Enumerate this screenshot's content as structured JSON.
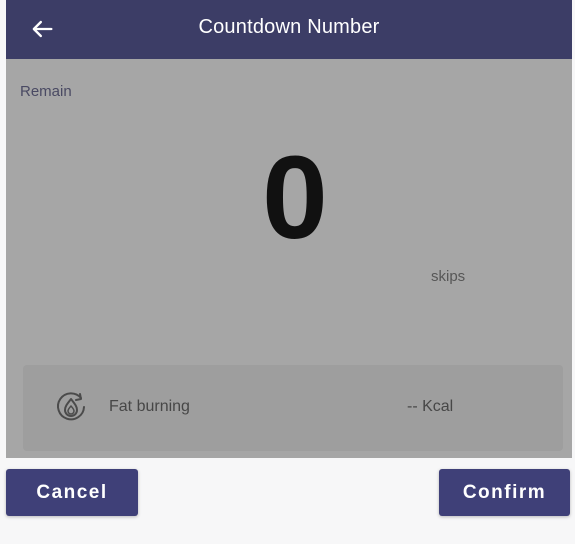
{
  "app_bar": {
    "title": "Countdown Number",
    "back_icon": "arrow-left-icon"
  },
  "panel": {
    "remain_label": "Remain",
    "countdown_value": "0",
    "unit_label": "skips"
  },
  "stats": {
    "fat_icon": "fat-burning-icon",
    "fat_label": "Fat burning",
    "fat_value": "-- Kcal"
  },
  "actions": {
    "cancel_label": "Cancel",
    "confirm_label": "Confirm"
  },
  "colors": {
    "header": "#3c3d66",
    "button": "#3f4078",
    "overlay": "#a6a6a6"
  }
}
